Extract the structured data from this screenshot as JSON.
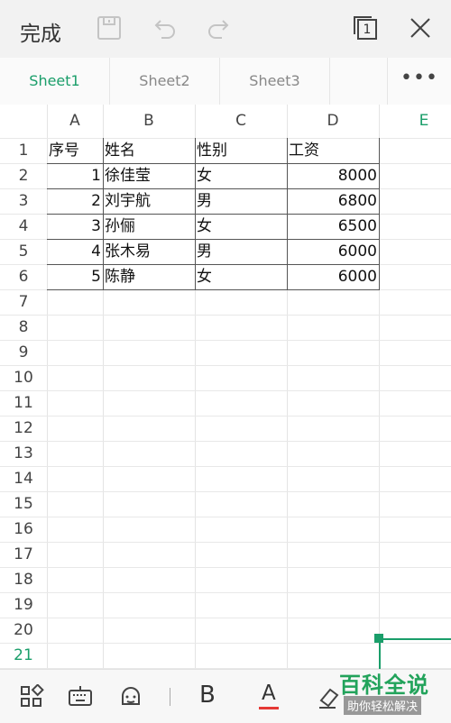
{
  "toolbar": {
    "done_label": "完成",
    "page_indicator": "1",
    "icons": [
      "save-icon",
      "undo-icon",
      "redo-icon",
      "page-count-icon",
      "close-icon"
    ]
  },
  "sheets": {
    "tabs": [
      "Sheet1",
      "Sheet2",
      "Sheet3"
    ],
    "active": "Sheet1",
    "more_label": "•••"
  },
  "grid": {
    "columns": [
      "A",
      "B",
      "C",
      "D",
      "E"
    ],
    "selected_column": "E",
    "rows": [
      "1",
      "2",
      "3",
      "4",
      "5",
      "6",
      "7",
      "8",
      "9",
      "10",
      "11",
      "12",
      "13",
      "14",
      "15",
      "16",
      "17",
      "18",
      "19",
      "20",
      "21"
    ],
    "selected_row": "21",
    "table": {
      "headers": [
        "序号",
        "姓名",
        "性别",
        "工资"
      ],
      "records": [
        [
          "1",
          "徐佳莹",
          "女",
          "8000"
        ],
        [
          "2",
          "刘宇航",
          "男",
          "6800"
        ],
        [
          "3",
          "孙俪",
          "女",
          "6500"
        ],
        [
          "4",
          "张木易",
          "男",
          "6000"
        ],
        [
          "5",
          "陈静",
          "女",
          "6000"
        ]
      ]
    }
  },
  "bottom_bar": {
    "bold_label": "B",
    "font_color_label": "A",
    "font_color": "#e53935",
    "icons": [
      "apps-icon",
      "keyboard-icon",
      "emoji-icon",
      "bold-icon",
      "font-color-icon",
      "eraser-icon"
    ]
  },
  "accent_color": "#1a9e6a",
  "watermark": {
    "title": "百科全说",
    "subtitle": "助你轻松解决"
  }
}
